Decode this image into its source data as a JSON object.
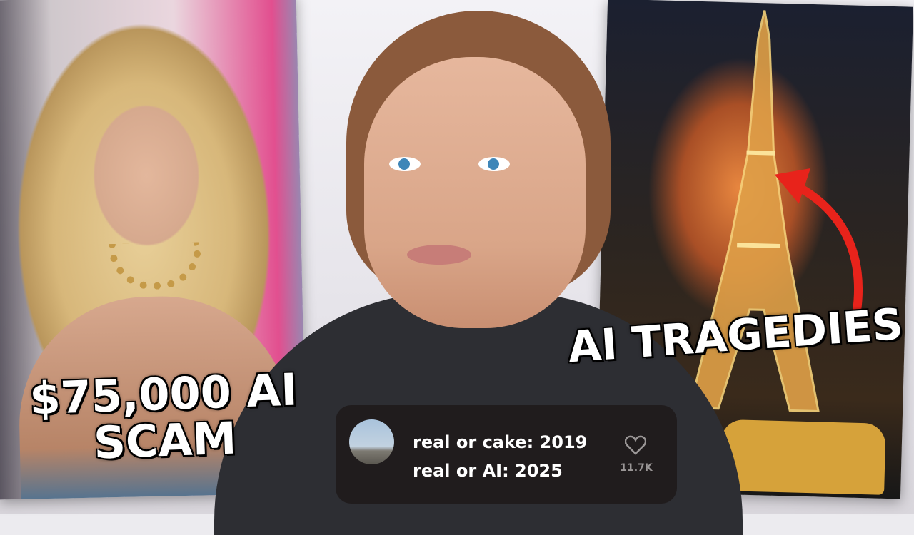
{
  "left_panel": {
    "caption": "$75,000 AI SCAM"
  },
  "right_panel": {
    "caption": "AI TRAGEDIES",
    "arrow_color": "#e8231b"
  },
  "comment": {
    "line1": "real or cake: 2019",
    "line2": "real or AI: 2025",
    "like_icon": "heart-icon",
    "like_count": "11.7K"
  }
}
